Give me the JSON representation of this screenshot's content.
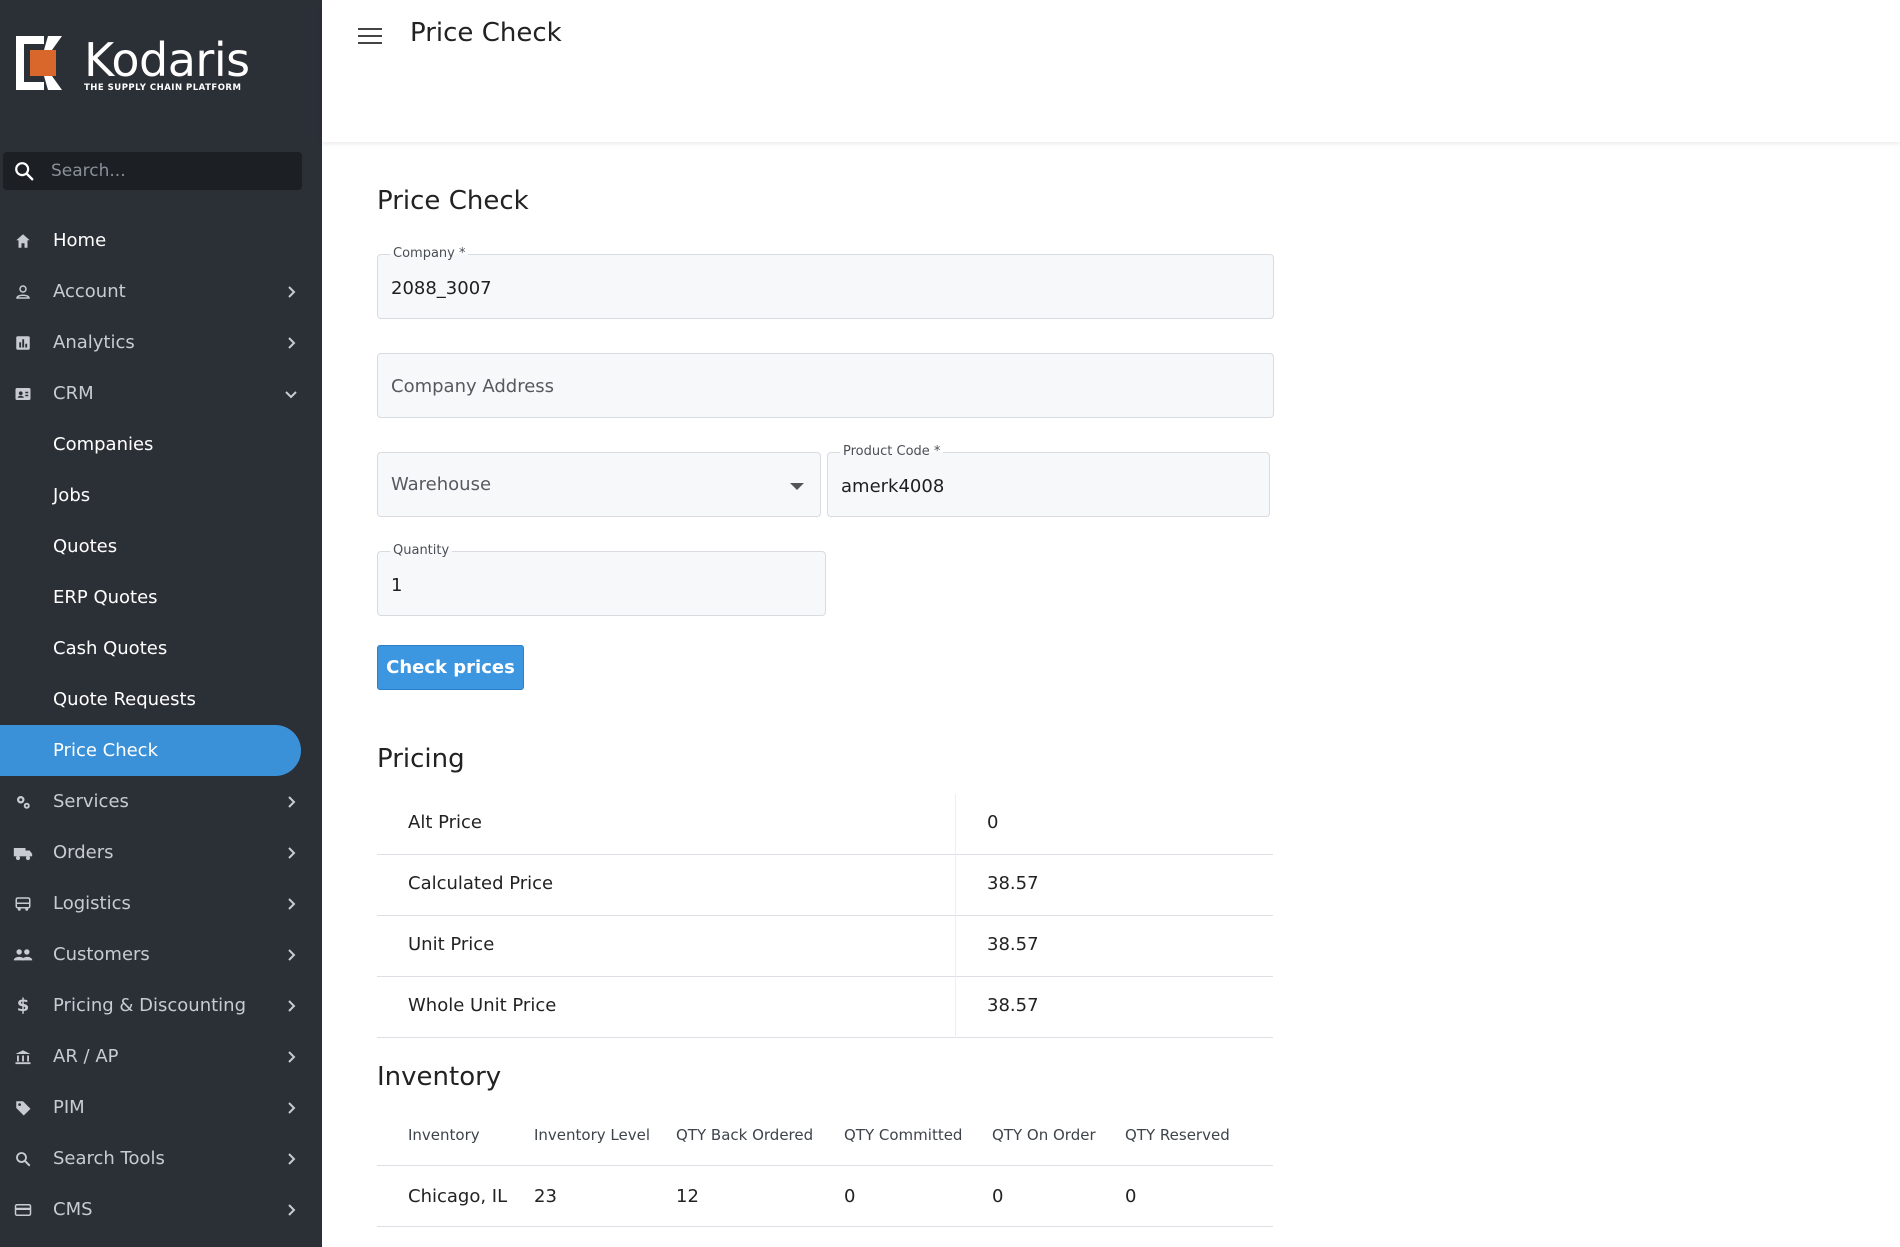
{
  "brand": {
    "name": "Kodaris",
    "tagline": "THE SUPPLY CHAIN PLATFORM"
  },
  "search": {
    "placeholder": "Search..."
  },
  "sidebar": {
    "items": [
      {
        "label": "Home",
        "icon": "home-icon"
      },
      {
        "label": "Account",
        "icon": "person-icon"
      },
      {
        "label": "Analytics",
        "icon": "chart-icon"
      },
      {
        "label": "CRM",
        "icon": "contact-card-icon"
      },
      {
        "label": "Companies"
      },
      {
        "label": "Jobs"
      },
      {
        "label": "Quotes"
      },
      {
        "label": "ERP Quotes"
      },
      {
        "label": "Cash Quotes"
      },
      {
        "label": "Quote Requests"
      },
      {
        "label": "Price Check"
      },
      {
        "label": "Services",
        "icon": "gears-icon"
      },
      {
        "label": "Orders",
        "icon": "truck-icon"
      },
      {
        "label": "Logistics",
        "icon": "bus-icon"
      },
      {
        "label": "Customers",
        "icon": "people-icon"
      },
      {
        "label": "Pricing & Discounting",
        "icon": "dollar-icon"
      },
      {
        "label": "AR / AP",
        "icon": "bank-icon"
      },
      {
        "label": "PIM",
        "icon": "tag-icon"
      },
      {
        "label": "Search Tools",
        "icon": "search-icon"
      },
      {
        "label": "CMS",
        "icon": "card-icon"
      }
    ]
  },
  "header": {
    "title": "Price Check"
  },
  "form": {
    "title": "Price Check",
    "company": {
      "label": "Company *",
      "value": "2088_3007"
    },
    "company_address": {
      "placeholder": "Company Address"
    },
    "warehouse": {
      "placeholder": "Warehouse"
    },
    "product_code": {
      "label": "Product Code *",
      "value": "amerk4008"
    },
    "quantity": {
      "label": "Quantity",
      "value": "1"
    },
    "submit_label": "Check prices"
  },
  "pricing": {
    "title": "Pricing",
    "rows": [
      {
        "label": "Alt Price",
        "value": "0"
      },
      {
        "label": "Calculated Price",
        "value": "38.57"
      },
      {
        "label": "Unit Price",
        "value": "38.57"
      },
      {
        "label": "Whole Unit Price",
        "value": "38.57"
      }
    ]
  },
  "inventory": {
    "title": "Inventory",
    "columns": [
      "Inventory",
      "Inventory Level",
      "QTY Back Ordered",
      "QTY Committed",
      "QTY On Order",
      "QTY Reserved"
    ],
    "rows": [
      [
        "Chicago, IL",
        "23",
        "12",
        "0",
        "0",
        "0"
      ]
    ]
  },
  "colors": {
    "sidebar": "#2b2f36",
    "accent": "#3b91d8",
    "brand_orange": "#d9662a"
  }
}
